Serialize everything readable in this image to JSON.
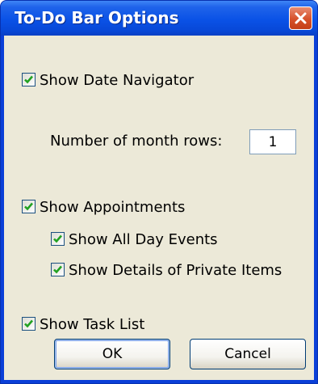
{
  "dialog": {
    "title": "To-Do Bar Options",
    "close_icon": "close-icon"
  },
  "options": {
    "show_date_navigator": {
      "label": "Show Date Navigator",
      "checked": true
    },
    "month_rows": {
      "label": "Number of month rows:",
      "value": "1"
    },
    "show_appointments": {
      "label": "Show Appointments",
      "checked": true
    },
    "show_all_day_events": {
      "label": "Show All Day Events",
      "checked": true
    },
    "show_private_details": {
      "label": "Show Details of Private Items",
      "checked": true
    },
    "show_task_list": {
      "label": "Show Task List",
      "checked": true
    }
  },
  "buttons": {
    "ok": "OK",
    "cancel": "Cancel"
  },
  "colors": {
    "titlebar": "#0a52e6",
    "client": "#ece9d8",
    "close_button": "#d6512a",
    "check_mark": "#21a121"
  }
}
